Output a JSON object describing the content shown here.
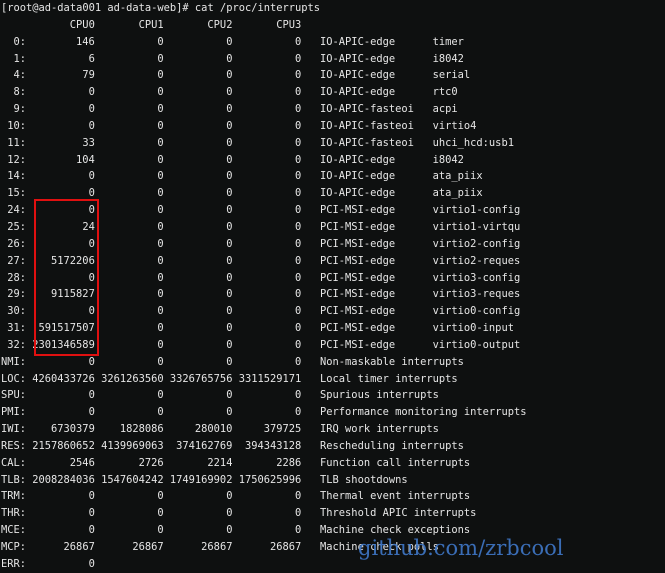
{
  "prompt": "[root@ad-data001 ad-data-web]# cat /proc/interrupts",
  "cpus": [
    "CPU0",
    "CPU1",
    "CPU2",
    "CPU3"
  ],
  "irq_rows": [
    {
      "irq": "0:",
      "v": [
        "146",
        "0",
        "0",
        "0"
      ],
      "chip": "IO-APIC-edge",
      "name": "timer"
    },
    {
      "irq": "1:",
      "v": [
        "6",
        "0",
        "0",
        "0"
      ],
      "chip": "IO-APIC-edge",
      "name": "i8042"
    },
    {
      "irq": "4:",
      "v": [
        "79",
        "0",
        "0",
        "0"
      ],
      "chip": "IO-APIC-edge",
      "name": "serial"
    },
    {
      "irq": "8:",
      "v": [
        "0",
        "0",
        "0",
        "0"
      ],
      "chip": "IO-APIC-edge",
      "name": "rtc0"
    },
    {
      "irq": "9:",
      "v": [
        "0",
        "0",
        "0",
        "0"
      ],
      "chip": "IO-APIC-fasteoi",
      "name": "acpi"
    },
    {
      "irq": "10:",
      "v": [
        "0",
        "0",
        "0",
        "0"
      ],
      "chip": "IO-APIC-fasteoi",
      "name": "virtio4"
    },
    {
      "irq": "11:",
      "v": [
        "33",
        "0",
        "0",
        "0"
      ],
      "chip": "IO-APIC-fasteoi",
      "name": "uhci_hcd:usb1"
    },
    {
      "irq": "12:",
      "v": [
        "104",
        "0",
        "0",
        "0"
      ],
      "chip": "IO-APIC-edge",
      "name": "i8042"
    },
    {
      "irq": "14:",
      "v": [
        "0",
        "0",
        "0",
        "0"
      ],
      "chip": "IO-APIC-edge",
      "name": "ata_piix"
    },
    {
      "irq": "15:",
      "v": [
        "0",
        "0",
        "0",
        "0"
      ],
      "chip": "IO-APIC-edge",
      "name": "ata_piix"
    },
    {
      "irq": "24:",
      "v": [
        "0",
        "0",
        "0",
        "0"
      ],
      "chip": "PCI-MSI-edge",
      "name": "virtio1-config"
    },
    {
      "irq": "25:",
      "v": [
        "24",
        "0",
        "0",
        "0"
      ],
      "chip": "PCI-MSI-edge",
      "name": "virtio1-virtqu"
    },
    {
      "irq": "26:",
      "v": [
        "0",
        "0",
        "0",
        "0"
      ],
      "chip": "PCI-MSI-edge",
      "name": "virtio2-config"
    },
    {
      "irq": "27:",
      "v": [
        "5172206",
        "0",
        "0",
        "0"
      ],
      "chip": "PCI-MSI-edge",
      "name": "virtio2-reques"
    },
    {
      "irq": "28:",
      "v": [
        "0",
        "0",
        "0",
        "0"
      ],
      "chip": "PCI-MSI-edge",
      "name": "virtio3-config"
    },
    {
      "irq": "29:",
      "v": [
        "9115827",
        "0",
        "0",
        "0"
      ],
      "chip": "PCI-MSI-edge",
      "name": "virtio3-reques"
    },
    {
      "irq": "30:",
      "v": [
        "0",
        "0",
        "0",
        "0"
      ],
      "chip": "PCI-MSI-edge",
      "name": "virtio0-config"
    },
    {
      "irq": "31:",
      "v": [
        "591517507",
        "0",
        "0",
        "0"
      ],
      "chip": "PCI-MSI-edge",
      "name": "virtio0-input"
    },
    {
      "irq": "32:",
      "v": [
        "2301346589",
        "0",
        "0",
        "0"
      ],
      "chip": "PCI-MSI-edge",
      "name": "virtio0-output"
    }
  ],
  "sys_rows": [
    {
      "irq": "NMI:",
      "v": [
        "0",
        "0",
        "0",
        "0"
      ],
      "desc": "Non-maskable interrupts"
    },
    {
      "irq": "LOC:",
      "v": [
        "4260433726",
        "3261263560",
        "3326765756",
        "3311529171"
      ],
      "desc": "Local timer interrupts"
    },
    {
      "irq": "SPU:",
      "v": [
        "0",
        "0",
        "0",
        "0"
      ],
      "desc": "Spurious interrupts"
    },
    {
      "irq": "PMI:",
      "v": [
        "0",
        "0",
        "0",
        "0"
      ],
      "desc": "Performance monitoring interrupts"
    },
    {
      "irq": "IWI:",
      "v": [
        "6730379",
        "1828086",
        "280010",
        "379725"
      ],
      "desc": "IRQ work interrupts"
    },
    {
      "irq": "RES:",
      "v": [
        "2157860652",
        "4139969063",
        "374162769",
        "394343128"
      ],
      "desc": "Rescheduling interrupts"
    },
    {
      "irq": "CAL:",
      "v": [
        "2546",
        "2726",
        "2214",
        "2286"
      ],
      "desc": "Function call interrupts"
    },
    {
      "irq": "TLB:",
      "v": [
        "2008284036",
        "1547604242",
        "1749169902",
        "1750625996"
      ],
      "desc": "TLB shootdowns"
    },
    {
      "irq": "TRM:",
      "v": [
        "0",
        "0",
        "0",
        "0"
      ],
      "desc": "Thermal event interrupts"
    },
    {
      "irq": "THR:",
      "v": [
        "0",
        "0",
        "0",
        "0"
      ],
      "desc": "Threshold APIC interrupts"
    },
    {
      "irq": "MCE:",
      "v": [
        "0",
        "0",
        "0",
        "0"
      ],
      "desc": "Machine check exceptions"
    },
    {
      "irq": "MCP:",
      "v": [
        "26867",
        "26867",
        "26867",
        "26867"
      ],
      "desc": "Machine check polls"
    },
    {
      "irq": "ERR:",
      "v": [
        "0"
      ],
      "desc": ""
    }
  ],
  "watermark": "github.com/zrbcool",
  "colors": {
    "highlight_box": "#e01010",
    "watermark": "#3f78c8",
    "text": "#e6e6e6",
    "background": "#0e1010"
  }
}
